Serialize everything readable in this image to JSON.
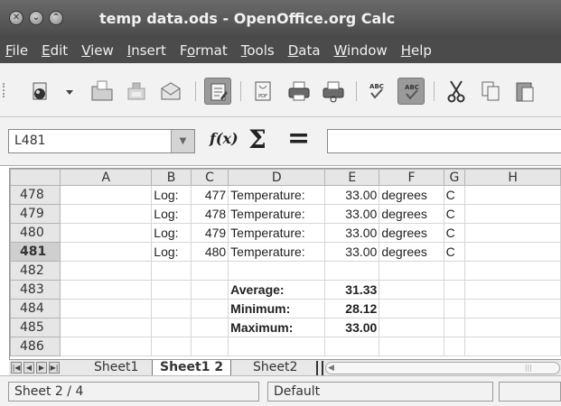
{
  "window": {
    "title": "temp data.ods - OpenOffice.org Calc"
  },
  "menubar": {
    "items": [
      {
        "accel": "F",
        "rest": "ile"
      },
      {
        "accel": "E",
        "rest": "dit"
      },
      {
        "accel": "V",
        "rest": "iew"
      },
      {
        "accel": "I",
        "rest": "nsert"
      },
      {
        "pre": "F",
        "accel": "o",
        "rest": "rmat"
      },
      {
        "accel": "T",
        "rest": "ools"
      },
      {
        "accel": "D",
        "rest": "ata"
      },
      {
        "accel": "W",
        "rest": "indow"
      },
      {
        "accel": "H",
        "rest": "elp"
      }
    ]
  },
  "toolbar": {
    "pdf_label": "PDF",
    "spell_label": "ABC",
    "autospell_label": "ABC"
  },
  "formula_bar": {
    "name_box": "L481",
    "fx_label": "f(x)",
    "sum_label": "Σ",
    "equals_label": "=",
    "formula_value": ""
  },
  "grid": {
    "columns": [
      "",
      "A",
      "B",
      "C",
      "D",
      "E",
      "F",
      "G",
      "H"
    ],
    "selected_row": "481",
    "rows": [
      {
        "row": "478",
        "A": "",
        "B": "Log:",
        "C": "477",
        "D": "Temperature:",
        "E": "33.00",
        "F": "degrees",
        "G": "C",
        "H": ""
      },
      {
        "row": "479",
        "A": "",
        "B": "Log:",
        "C": "478",
        "D": "Temperature:",
        "E": "33.00",
        "F": "degrees",
        "G": "C",
        "H": ""
      },
      {
        "row": "480",
        "A": "",
        "B": "Log:",
        "C": "479",
        "D": "Temperature:",
        "E": "33.00",
        "F": "degrees",
        "G": "C",
        "H": ""
      },
      {
        "row": "481",
        "A": "",
        "B": "Log:",
        "C": "480",
        "D": "Temperature:",
        "E": "33.00",
        "F": "degrees",
        "G": "C",
        "H": ""
      },
      {
        "row": "482",
        "A": "",
        "B": "",
        "C": "",
        "D": "",
        "E": "",
        "F": "",
        "G": "",
        "H": ""
      },
      {
        "row": "483",
        "A": "",
        "B": "",
        "C": "",
        "D": "Average:",
        "E": "31.33",
        "F": "",
        "G": "",
        "H": ""
      },
      {
        "row": "484",
        "A": "",
        "B": "",
        "C": "",
        "D": "Minimum:",
        "E": "28.12",
        "F": "",
        "G": "",
        "H": ""
      },
      {
        "row": "485",
        "A": "",
        "B": "",
        "C": "",
        "D": "Maximum:",
        "E": "33.00",
        "F": "",
        "G": "",
        "H": ""
      },
      {
        "row": "486",
        "A": "",
        "B": "",
        "C": "",
        "D": "",
        "E": "",
        "F": "",
        "G": "",
        "H": ""
      }
    ]
  },
  "sheet_tabs": {
    "tabs": [
      "Sheet1",
      "Sheet1_2",
      "Sheet2"
    ],
    "active": "Sheet1_2"
  },
  "statusbar": {
    "sheet_position": "Sheet 2 / 4",
    "page_style": "Default"
  },
  "colors": {
    "titlebar": "#4a4a4a",
    "menubar": "#4b4b4b",
    "header_bg": "#e6e6e6",
    "selected_header": "#cfcfcf"
  }
}
